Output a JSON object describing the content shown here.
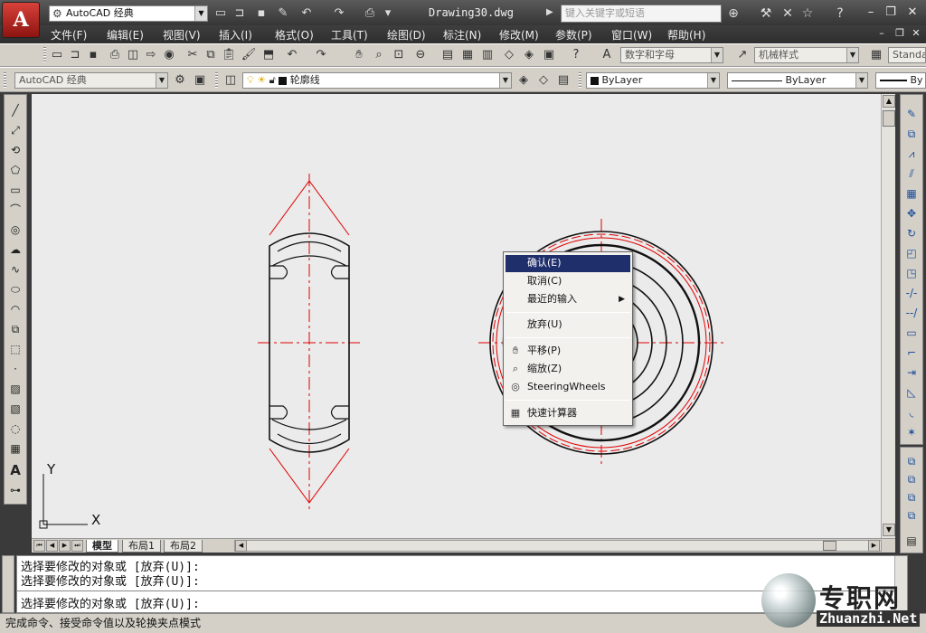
{
  "title_bar": {
    "app_letter": "A",
    "workspace": "AutoCAD 经典",
    "document_title": "Drawing30.dwg",
    "search_placeholder": "键入关键字或短语",
    "more_indicator": "▶"
  },
  "menu": {
    "items": [
      "文件(F)",
      "编辑(E)",
      "视图(V)",
      "插入(I)",
      "格式(O)",
      "工具(T)",
      "绘图(D)",
      "标注(N)",
      "修改(M)",
      "参数(P)",
      "窗口(W)",
      "帮助(H)"
    ]
  },
  "toolbar1": {
    "text_style": "数字和字母",
    "dim_style": "机械样式",
    "table_style": "Standa"
  },
  "toolbar2": {
    "workspace": "AutoCAD 经典",
    "layer": "轮廓线",
    "color": "ByLayer",
    "linetype": "ByLayer",
    "lineweight": "By"
  },
  "canvas": {
    "ucs_x": "X",
    "ucs_y": "Y"
  },
  "tabs": [
    "模型",
    "布局1",
    "布局2"
  ],
  "context_menu": {
    "items": [
      {
        "label": "确认(E)",
        "highlighted": true
      },
      {
        "label": "取消(C)"
      },
      {
        "label": "最近的输入",
        "submenu": "▶"
      },
      {
        "label": "放弃(U)"
      },
      {
        "label": "平移(P)",
        "icon": "pan-icon"
      },
      {
        "label": "缩放(Z)",
        "icon": "zoom-icon"
      },
      {
        "label": "SteeringWheels",
        "icon": "steeringwheel-icon"
      },
      {
        "label": "快速计算器",
        "icon": "calculator-icon"
      }
    ]
  },
  "command": {
    "lines": [
      "选择要修改的对象或 [放弃(U)]:",
      "选择要修改的对象或 [放弃(U)]:",
      "选择要修改的对象或 [放弃(U)]:"
    ]
  },
  "status_text": "完成命令、接受命令值以及轮换夹点模式",
  "watermark": {
    "cn": "专职网",
    "url": "Zhuanzhi.Net"
  },
  "colors": {
    "canvas_bg": "#ebebeb",
    "drawing_line": "#111111",
    "center_line": "#e00000",
    "menu_highlight": "#1f2f6b",
    "app_button": "#c8312a"
  }
}
